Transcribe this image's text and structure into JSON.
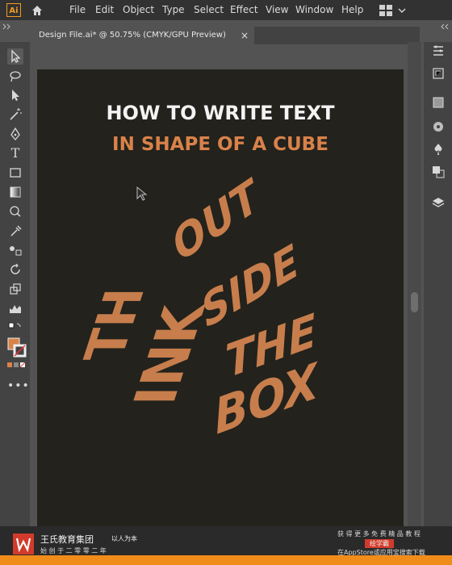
{
  "app": {
    "logo": "Ai",
    "menu": [
      "File",
      "Edit",
      "Object",
      "Type",
      "Select",
      "Effect",
      "View",
      "Window",
      "Help"
    ]
  },
  "tab": {
    "title": "Design File.ai* @ 50.75% (CMYK/GPU Preview)",
    "close": "×"
  },
  "artwork": {
    "headline_1": "HOW TO WRITE TEXT",
    "headline_2": "IN SHAPE OF A CUBE",
    "cube_words": [
      "OUT",
      "SIDE",
      "TH",
      "INK",
      "THE",
      "BOX"
    ]
  },
  "footer": {
    "brand": "王氏教育集团",
    "slogan": "以人为本",
    "tagline": "始 创 于 二 零 零 二 年",
    "promo_1": "获 得 更 多 免 费 精 品 教 程",
    "promo_app": "绘学霸",
    "promo_2": "在AppStore或应用宝搜索下载"
  },
  "colors": {
    "ui_dark": "#323232",
    "panel": "#434343",
    "canvas": "#535353",
    "artboard": "#23221d",
    "headline_white": "#f3f3f3",
    "accent_orange": "#d9824a",
    "cube_orange": "#c77e4c",
    "footer_stripe": "#f08c1a",
    "footer_logo": "#d23b2b"
  },
  "icons": [
    "home-icon",
    "workspace-switcher-icon",
    "selection-tool-icon",
    "direct-selection-icon",
    "pen-tool-icon",
    "type-tool-icon",
    "rectangle-tool-icon",
    "gradient-tool-icon",
    "eyedropper-icon",
    "fill-stroke-icon",
    "properties-panel-icon",
    "layers-panel-icon",
    "cursor-icon"
  ]
}
